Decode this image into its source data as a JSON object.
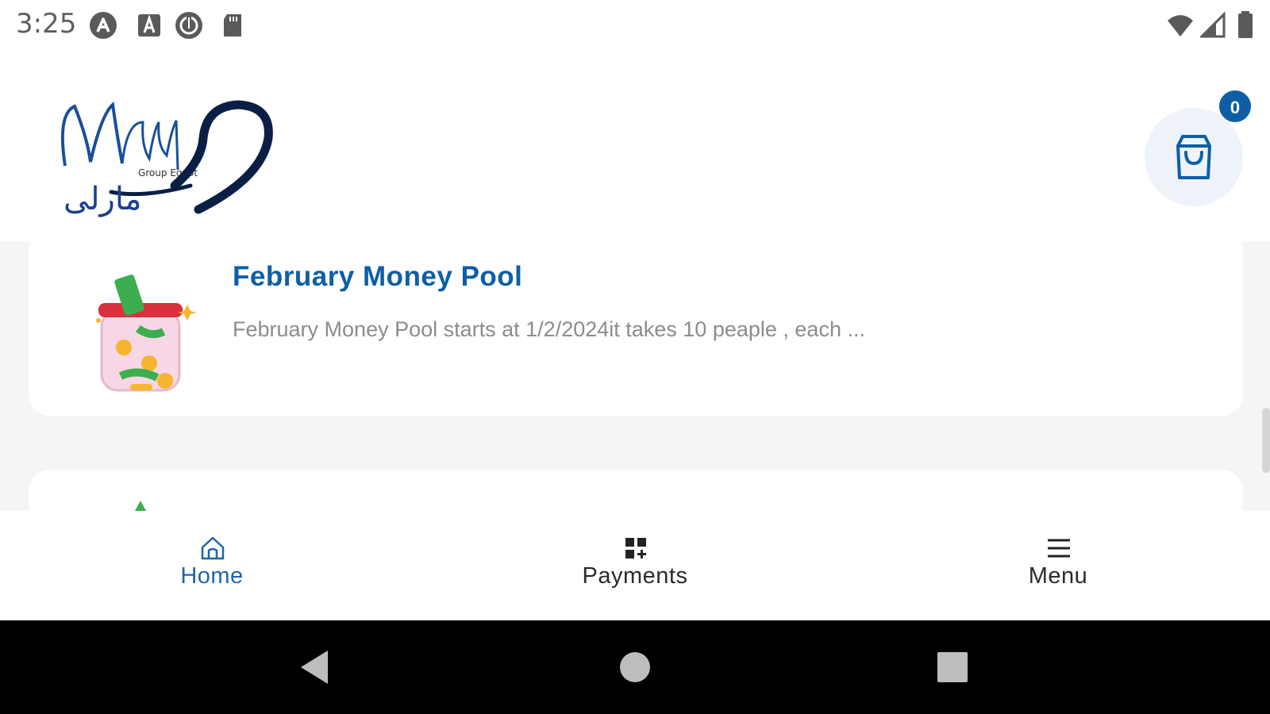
{
  "status_bar": {
    "time": "3:25",
    "left_icons": [
      "app-notification-icon",
      "keyboard-a-icon",
      "app-badge-icon",
      "sd-card-icon"
    ],
    "right_icons": [
      "wifi-icon",
      "cell-signal-icon",
      "battery-icon"
    ]
  },
  "header": {
    "logo_alt": "Marly",
    "logo_script": "Marly",
    "logo_small": "Group Egypt",
    "logo_arabic": "مارلى",
    "cart_count": "0"
  },
  "cards": [
    {
      "title": "February Money Pool",
      "description": "February Money Pool starts at 1/2/2024it takes 10 peaple , each ...",
      "icon": "money-jar-icon"
    }
  ],
  "bottom_nav": {
    "items": [
      {
        "label": "Home",
        "icon": "home-icon",
        "active": true
      },
      {
        "label": "Payments",
        "icon": "payments-grid-icon",
        "active": false
      },
      {
        "label": "Menu",
        "icon": "menu-icon",
        "active": false
      }
    ]
  },
  "colors": {
    "accent": "#0d5ea6",
    "nav_active": "#1f64ad",
    "background": "#f5f5f5"
  }
}
